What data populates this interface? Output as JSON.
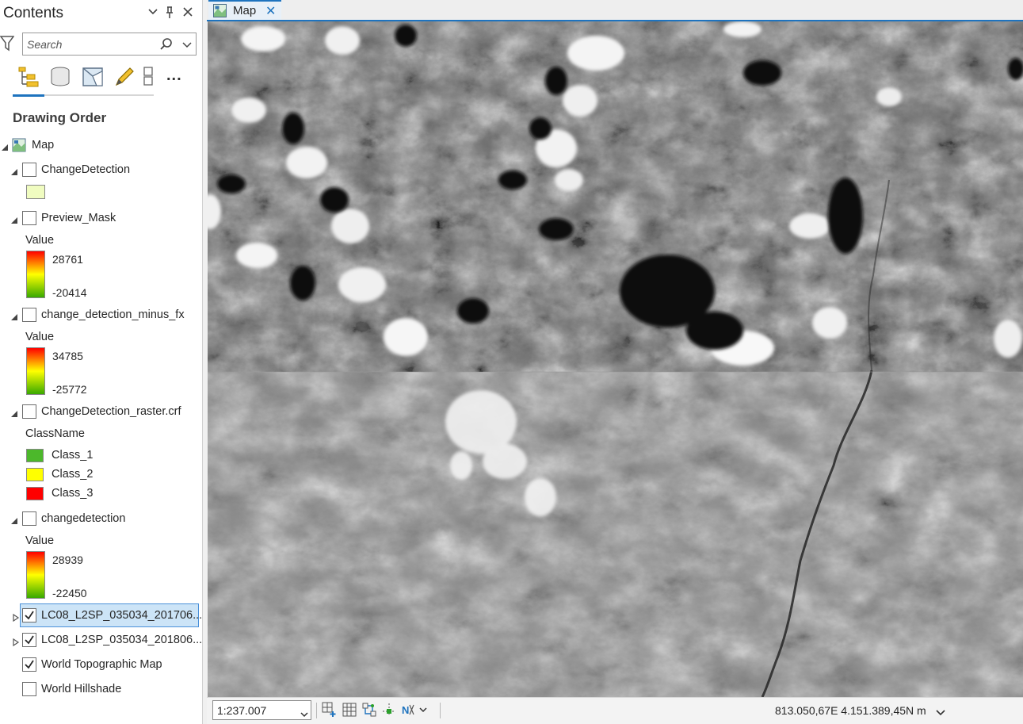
{
  "contents_pane": {
    "title": "Contents",
    "controls": {
      "dropdown": "⌄",
      "pin": "⊥",
      "close": "✕"
    },
    "search": {
      "placeholder": "Search",
      "value": ""
    },
    "drawing_order_label": "Drawing Order",
    "toolbar_more": "...",
    "map_node": {
      "label": "Map"
    },
    "layers": [
      {
        "name": "ChangeDetection",
        "checked": false,
        "expanded": true,
        "legend": {
          "type": "fill",
          "color": "#f0fcc0"
        }
      },
      {
        "name": "Preview_Mask",
        "checked": false,
        "expanded": true,
        "legend": {
          "type": "ramp",
          "title": "Value",
          "high": "28761",
          "low": "-20414"
        }
      },
      {
        "name": "change_detection_minus_fx",
        "checked": false,
        "expanded": true,
        "legend": {
          "type": "ramp",
          "title": "Value",
          "high": "34785",
          "low": "-25772"
        }
      },
      {
        "name": "ChangeDetection_raster.crf",
        "checked": false,
        "expanded": true,
        "legend": {
          "type": "classes",
          "title": "ClassName",
          "classes": [
            {
              "label": "Class_1",
              "color": "#4cb82b"
            },
            {
              "label": "Class_2",
              "color": "#ffff00"
            },
            {
              "label": "Class_3",
              "color": "#ff0000"
            }
          ]
        }
      },
      {
        "name": "changedetection",
        "checked": false,
        "expanded": true,
        "legend": {
          "type": "ramp",
          "title": "Value",
          "high": "28939",
          "low": "-22450"
        }
      },
      {
        "name": "LC08_L2SP_035034_201706...",
        "checked": true,
        "expanded": false,
        "selected": true
      },
      {
        "name": "LC08_L2SP_035034_201806...",
        "checked": true,
        "expanded": false
      },
      {
        "name": "World Topographic Map",
        "checked": true,
        "expanded": false
      },
      {
        "name": "World Hillshade",
        "checked": false,
        "expanded": false
      }
    ]
  },
  "map_view": {
    "tab_label": "Map",
    "tab_close": "✕",
    "scale": "1:237.007",
    "coordinates": "813.050,67E 4.151.389,45N m"
  },
  "colors": {
    "accent": "#1e73be",
    "selection": "#cce4f7",
    "ramp_high": "#ff0000",
    "ramp_mid": "#ffff00",
    "ramp_low": "#38a800"
  }
}
